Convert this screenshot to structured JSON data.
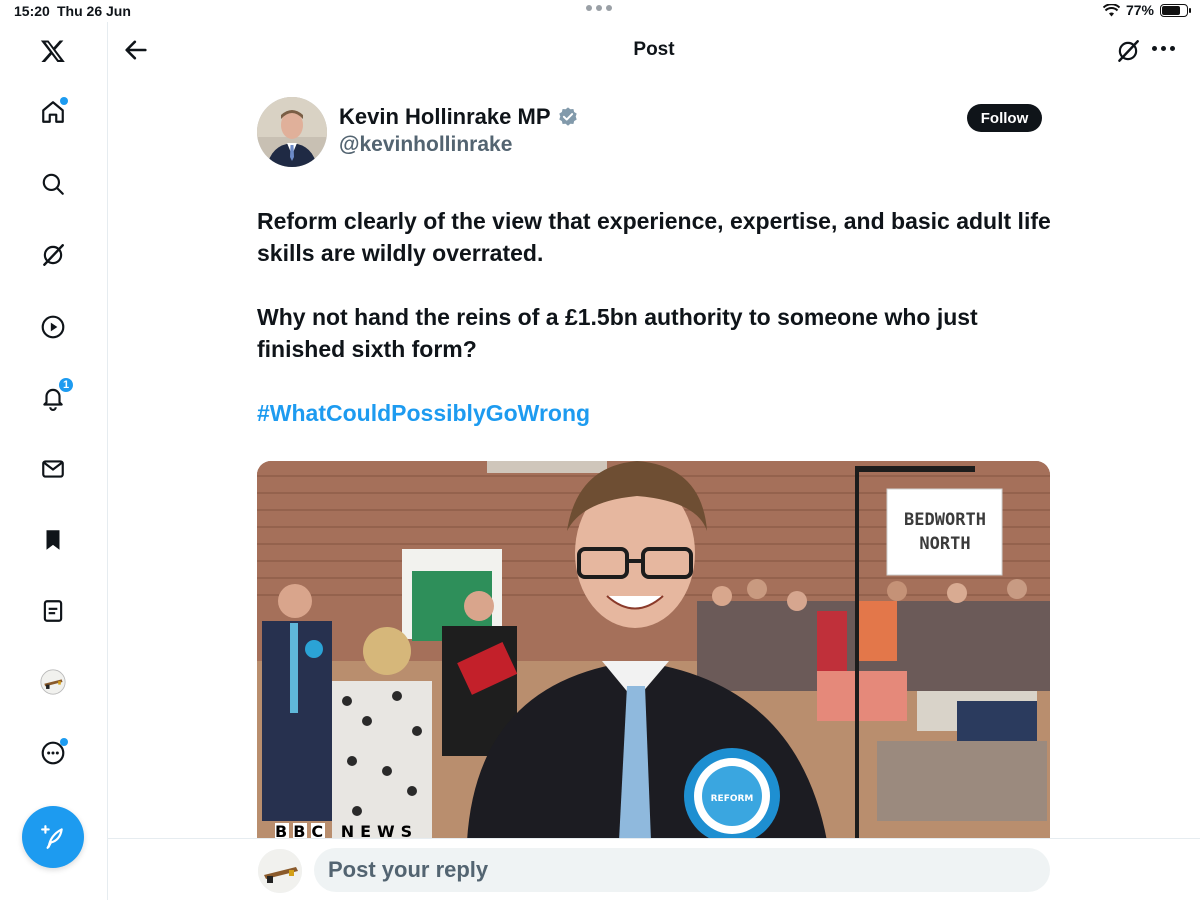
{
  "status_bar": {
    "time": "15:20",
    "date": "Thu 26 Jun",
    "battery": "77%",
    "battery_level": 0.77
  },
  "sidebar": {
    "items": [
      {
        "name": "home",
        "icon": "home-icon",
        "has_dot": true
      },
      {
        "name": "explore",
        "icon": "search-icon"
      },
      {
        "name": "grok",
        "icon": "grok-icon"
      },
      {
        "name": "video",
        "icon": "play-icon"
      },
      {
        "name": "notifications",
        "icon": "bell-icon",
        "badge": "1"
      },
      {
        "name": "messages",
        "icon": "mail-icon"
      },
      {
        "name": "bookmarks",
        "icon": "bookmark-icon"
      },
      {
        "name": "lists",
        "icon": "list-icon"
      },
      {
        "name": "profile",
        "icon": "avatar"
      },
      {
        "name": "more",
        "icon": "more-circle-icon",
        "has_dot": true
      }
    ],
    "compose_icon": "compose-feather-icon"
  },
  "header": {
    "title": "Post"
  },
  "tweet": {
    "author_name": "Kevin Hollinrake MP",
    "handle": "@kevinhollinrake",
    "follow_label": "Follow",
    "paragraph_1": "Reform clearly of the view that experience, expertise, and basic adult life skills are wildly overrated.",
    "paragraph_2": "Why not hand the reins of a £1.5bn authority to someone who just finished sixth form?",
    "hashtag": "#WhatCouldPossiblyGoWrong",
    "media": {
      "sign_line_1": "BEDWORTH",
      "sign_line_2": "NORTH",
      "rosette_text": "REFORM",
      "watermark": "BBC NEWS"
    }
  },
  "reply": {
    "placeholder": "Post your reply"
  },
  "colors": {
    "accent": "#1d9bf0",
    "text": "#0f1419",
    "secondary": "#536471"
  }
}
